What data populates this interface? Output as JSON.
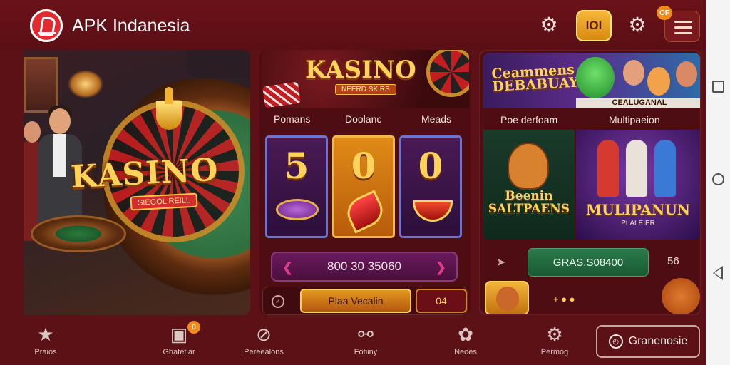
{
  "header": {
    "app_title": "APK Indanesia",
    "icons": [
      "logo-icon",
      "gear-icon",
      "coin-icon",
      "gear-icon",
      "menu-icon"
    ],
    "coin_label": "IOI",
    "badge": "OF"
  },
  "left_panel": {
    "logo_text": "KASINO",
    "logo_sub": "SIEGOL REILL"
  },
  "middle_panel": {
    "banner_title": "KASINO",
    "banner_sub": "NEERD SKIRS",
    "labels": [
      "Pomans",
      "Doolanc",
      "Meads"
    ],
    "reels": [
      "5",
      "0",
      "0"
    ],
    "amount": "800 30 35060",
    "place_button": "Plaa Vecalin",
    "count_button": "04"
  },
  "right_panel": {
    "banner_title": "Ceammens DEBABUAY",
    "banner_strip": "CEALUGANAL",
    "tabs": [
      "Poe derfoam",
      "Multipaeion"
    ],
    "card1_title": "Beenin SALTPAENS",
    "card2_title": "MULIPANUN",
    "card2_sub": "PLALEIER",
    "green_button": "GRAS.S08400",
    "number": "56",
    "coins": "+ ● ●"
  },
  "bottom_nav": {
    "items": [
      {
        "label": "Praios",
        "icon": "star-icon"
      },
      {
        "label": "Ghatetiar",
        "icon": "wallet-icon",
        "badge": "0"
      },
      {
        "label": "Pereealons",
        "icon": "compass-icon"
      },
      {
        "label": "Fotiiny",
        "icon": "share-icon"
      },
      {
        "label": "Neoes",
        "icon": "globe-icon"
      },
      {
        "label": "Permog",
        "icon": "gear-icon"
      }
    ],
    "button_label": "Granenosie"
  },
  "colors": {
    "background": "#5c1116",
    "accent_gold": "#ffd35a",
    "accent_orange": "#f08a1c"
  }
}
